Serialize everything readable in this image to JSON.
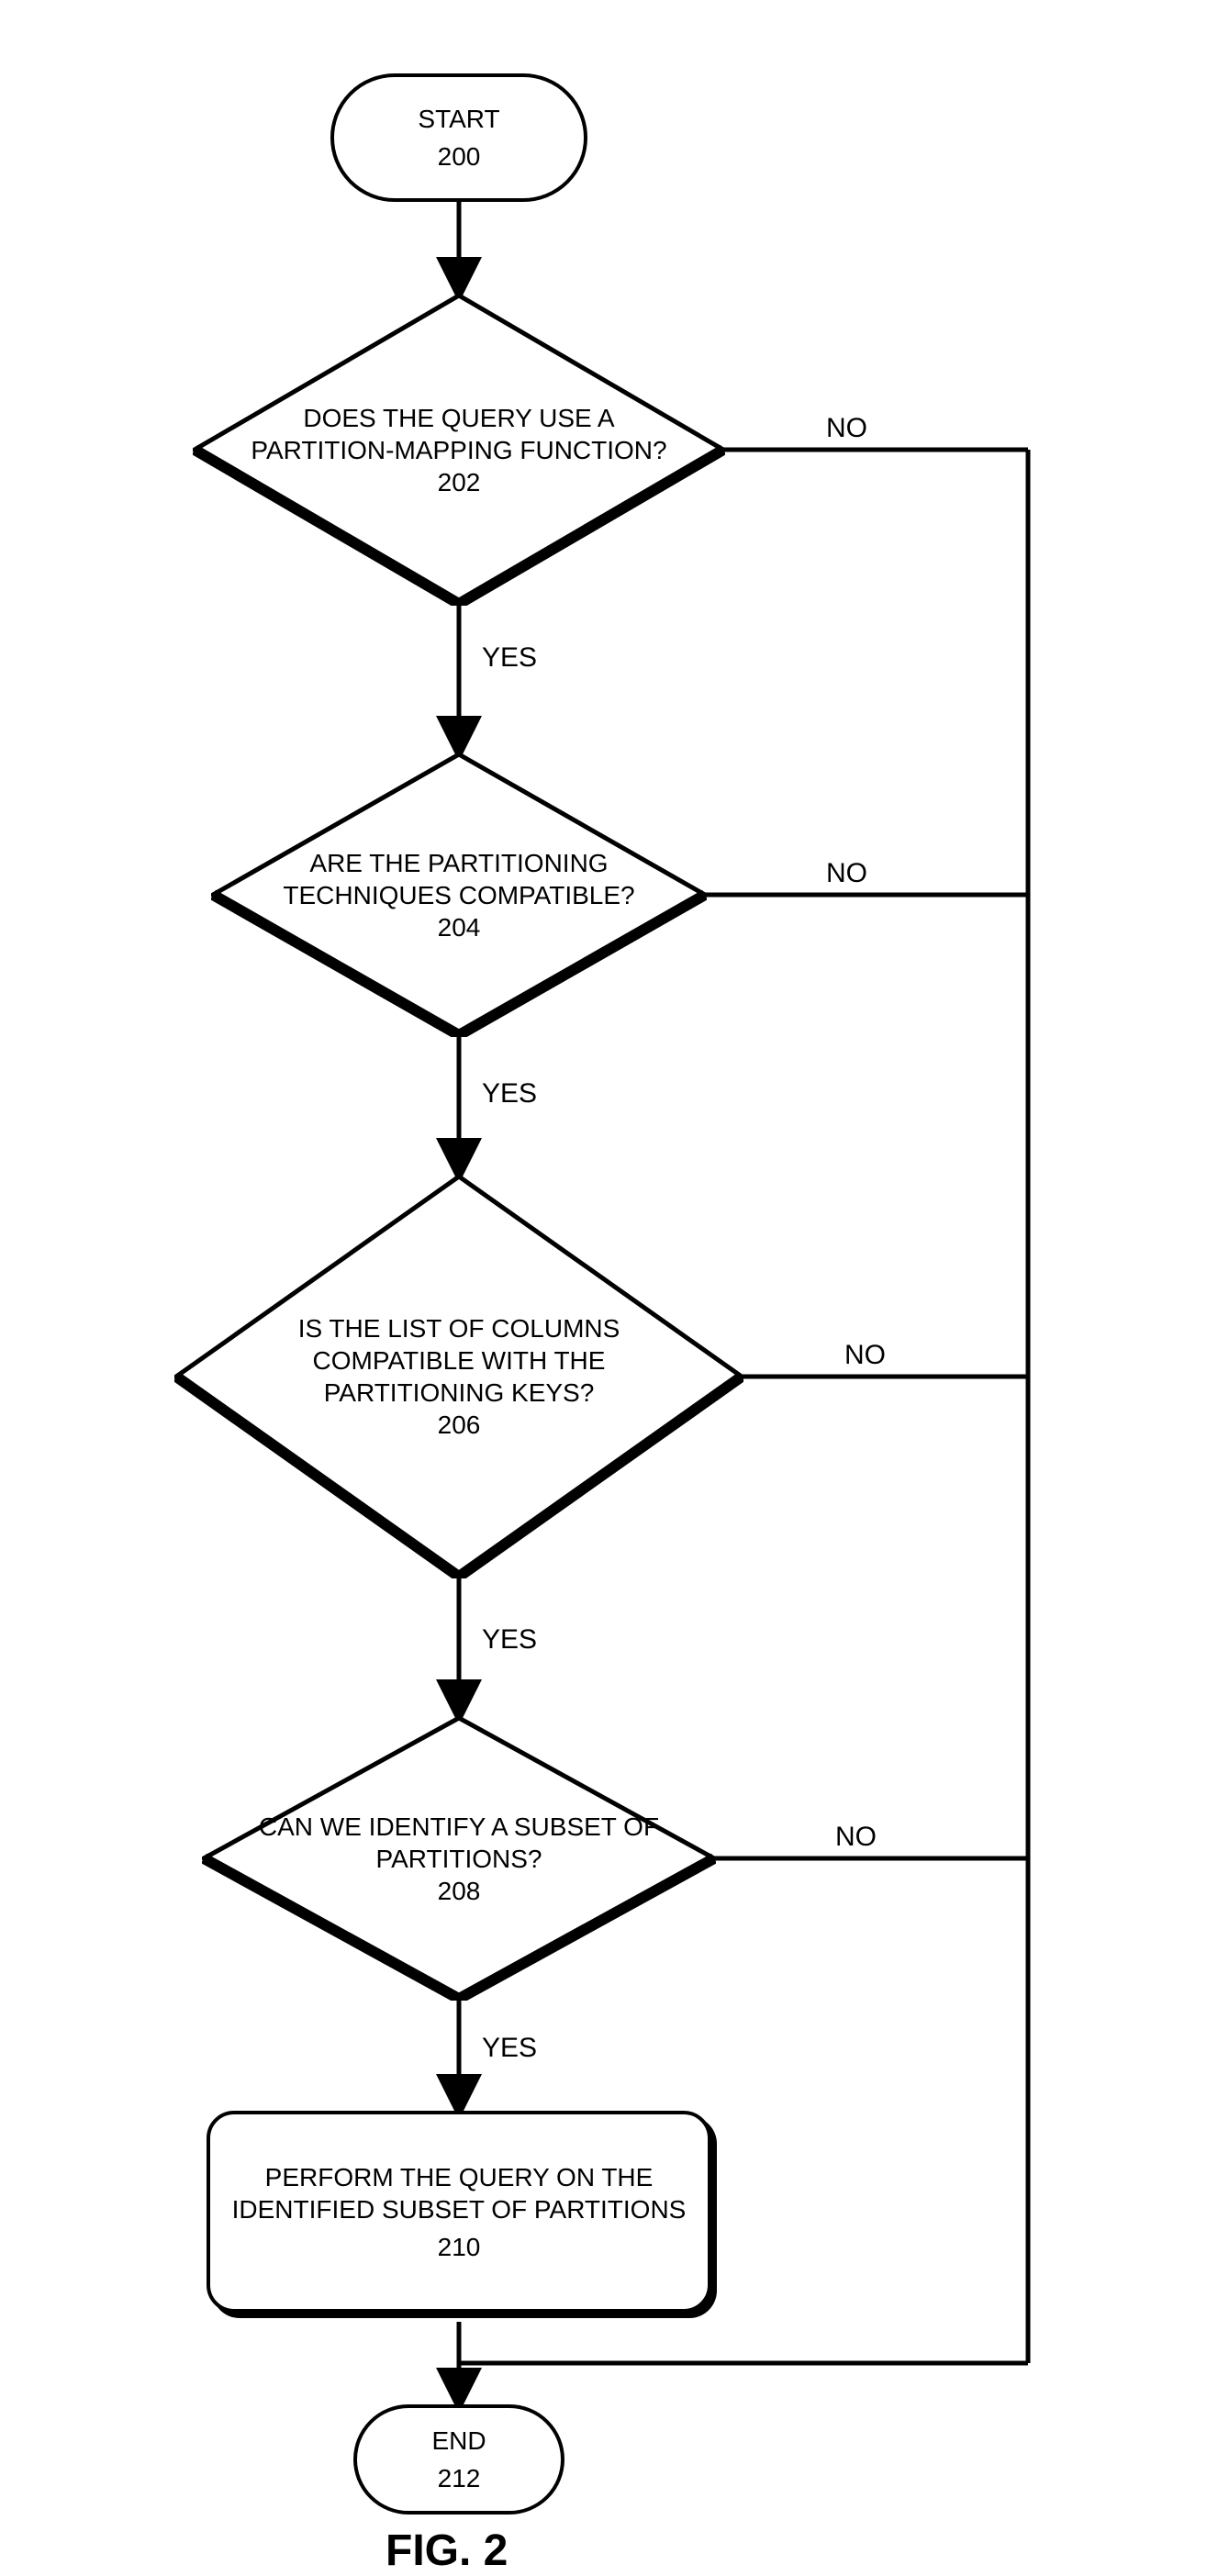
{
  "chart_data": {
    "type": "flowchart",
    "title": "FIG. 2",
    "nodes": [
      {
        "id": "200",
        "kind": "terminator",
        "label": "START",
        "ref": "200"
      },
      {
        "id": "202",
        "kind": "decision",
        "label": "DOES THE QUERY USE A PARTITION-MAPPING FUNCTION?",
        "ref": "202"
      },
      {
        "id": "204",
        "kind": "decision",
        "label": "ARE THE PARTITIONING TECHNIQUES COMPATIBLE?",
        "ref": "204"
      },
      {
        "id": "206",
        "kind": "decision",
        "label": "IS THE LIST OF COLUMNS COMPATIBLE WITH THE PARTITIONING KEYS?",
        "ref": "206"
      },
      {
        "id": "208",
        "kind": "decision",
        "label": "CAN WE IDENTIFY A SUBSET OF PARTITIONS?",
        "ref": "208"
      },
      {
        "id": "210",
        "kind": "process",
        "label": "PERFORM THE QUERY ON THE IDENTIFIED SUBSET OF PARTITIONS",
        "ref": "210"
      },
      {
        "id": "212",
        "kind": "terminator",
        "label": "END",
        "ref": "212"
      }
    ],
    "edges": [
      {
        "from": "200",
        "to": "202",
        "label": ""
      },
      {
        "from": "202",
        "to": "204",
        "label": "YES"
      },
      {
        "from": "202",
        "to": "212",
        "label": "NO"
      },
      {
        "from": "204",
        "to": "206",
        "label": "YES"
      },
      {
        "from": "204",
        "to": "212",
        "label": "NO"
      },
      {
        "from": "206",
        "to": "208",
        "label": "YES"
      },
      {
        "from": "206",
        "to": "212",
        "label": "NO"
      },
      {
        "from": "208",
        "to": "210",
        "label": "YES"
      },
      {
        "from": "208",
        "to": "212",
        "label": "NO"
      },
      {
        "from": "210",
        "to": "212",
        "label": ""
      }
    ]
  },
  "labels": {
    "yes": "YES",
    "no": "NO"
  },
  "caption": "FIG. 2"
}
